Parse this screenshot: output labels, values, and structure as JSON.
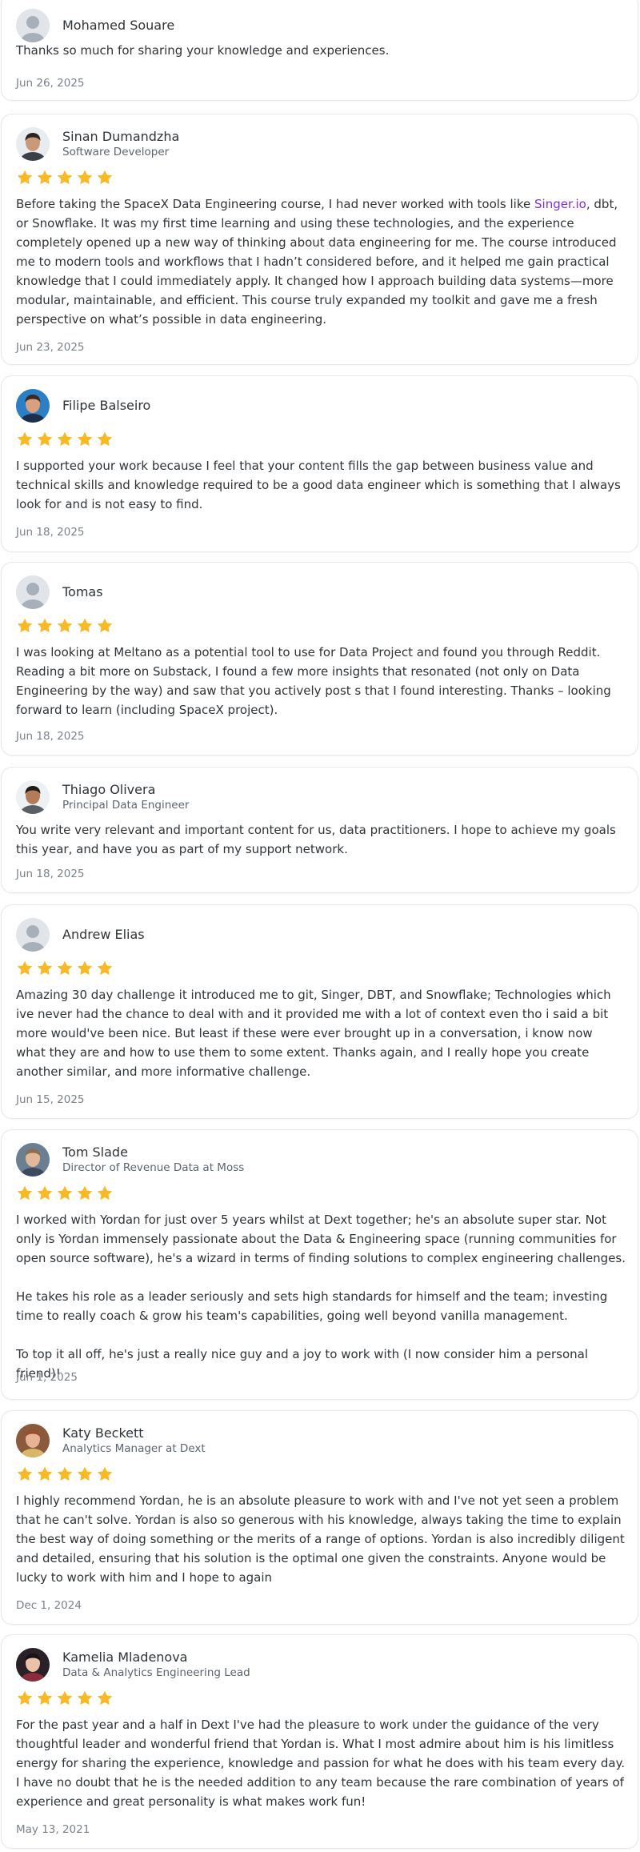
{
  "colors": {
    "star": "#f7b924",
    "link": "#7b2fe0",
    "border": "#e6e8eb",
    "muted": "#7a828c"
  },
  "reviews": [
    {
      "name": "Mohamed Souare",
      "role": "",
      "avatar": "default-avatar",
      "stars": 0,
      "paragraphs": [
        "Thanks so much for sharing your knowledge and experiences."
      ],
      "date": "Jun 26, 2025"
    },
    {
      "name": "Sinan Dumandzha",
      "role": "Software Developer",
      "avatar": "photo-avatar",
      "stars": 5,
      "pre_link": "Before taking the SpaceX Data Engineering course, I had never worked with tools like ",
      "link_text": "Singer.io",
      "post_link": ", dbt, or Snowflake. It was my first time learning and using these technologies, and the experience completely opened up a new way of thinking about data engineering for me. The course introduced me to modern tools and workflows that I hadn’t considered before, and it helped me gain practical knowledge that I could immediately apply. It changed how I approach building data systems—more modular, maintainable, and efficient. This course truly expanded my toolkit and gave me a fresh perspective on what’s possible in data engineering.",
      "date": "Jun 23, 2025"
    },
    {
      "name": "Filipe Balseiro",
      "role": "",
      "avatar": "photo-avatar",
      "stars": 5,
      "paragraphs": [
        "I supported your work because I feel that your content fills the gap between business value and technical skills and knowledge required to be a good data engineer which is something that I always look for and is not easy to find."
      ],
      "date": "Jun 18, 2025"
    },
    {
      "name": "Tomas",
      "role": "",
      "avatar": "default-avatar",
      "stars": 5,
      "paragraphs": [
        "I was looking at Meltano as a potential tool to use for Data Project and found you through Reddit. Reading a bit more on Substack, I found a few more insights that resonated (not only on Data Engineering by the way) and saw that you actively post s that I found interesting. Thanks – looking forward to learn (including SpaceX project)."
      ],
      "date": "Jun 18, 2025"
    },
    {
      "name": "Thiago Olivera",
      "role": "Principal Data Engineer",
      "avatar": "photo-avatar",
      "stars": 0,
      "paragraphs": [
        "You write very relevant and important content for us, data practitioners. I hope to achieve my goals this year, and have you as part of my support network."
      ],
      "date": "Jun 18, 2025"
    },
    {
      "name": "Andrew Elias",
      "role": "",
      "avatar": "default-avatar",
      "stars": 5,
      "paragraphs": [
        "Amazing 30 day challenge it introduced me to git, Singer, DBT, and Snowflake; Technologies which ive never had the chance to deal with and it provided me with a lot of context even tho i said a bit more would've been nice. But least if these were ever brought up in a conversation, i know now what they are and how to use them to some extent. Thanks again, and I really hope you create another similar, and more informative challenge."
      ],
      "date": "Jun 15, 2025"
    },
    {
      "name": "Tom Slade",
      "role": "Director of Revenue Data at Moss",
      "avatar": "photo-avatar",
      "stars": 5,
      "paragraphs": [
        "I worked with Yordan for just over 5 years whilst at Dext together; he's an absolute super star. Not only is Yordan immensely passionate about the Data & Engineering space (running communities for open source software), he's a wizard in terms of finding solutions to complex engineering challenges.",
        "He takes his role as a leader seriously and sets high standards for himself and the team; investing time to really coach & grow his team's capabilities, going well beyond vanilla management.",
        "To top it all off, he's just a really nice guy and a joy to work with (I now consider him a personal friend)!"
      ],
      "date": "Jun 1, 2025"
    },
    {
      "name": "Katy Beckett",
      "role": "Analytics Manager at Dext",
      "avatar": "photo-avatar",
      "stars": 5,
      "paragraphs": [
        "I highly recommend Yordan, he is an absolute pleasure to work with and I've not yet seen a problem that he can't solve. Yordan is also so generous with his knowledge, always taking the time to explain the best way of doing something or the merits of a range of options. Yordan is also incredibly diligent and detailed, ensuring that his solution is the optimal one given the constraints. Anyone would be lucky to work with him and I hope to again"
      ],
      "date": "Dec 1, 2024"
    },
    {
      "name": "Kamelia Mladenova",
      "role": "Data & Analytics Engineering Lead",
      "avatar": "photo-avatar",
      "stars": 5,
      "paragraphs": [
        "For the past year and a half in Dext I've had the pleasure to work under the guidance of the very thoughtful leader and wonderful friend that Yordan is. What I most admire about him is his limitless energy for sharing the experience, knowledge and passion for what he does with his team every day.",
        "I have no doubt that he is the needed addition to any team because the rare combination of years of experience and great personality is what makes work fun!"
      ],
      "date": "May 13, 2021"
    }
  ]
}
